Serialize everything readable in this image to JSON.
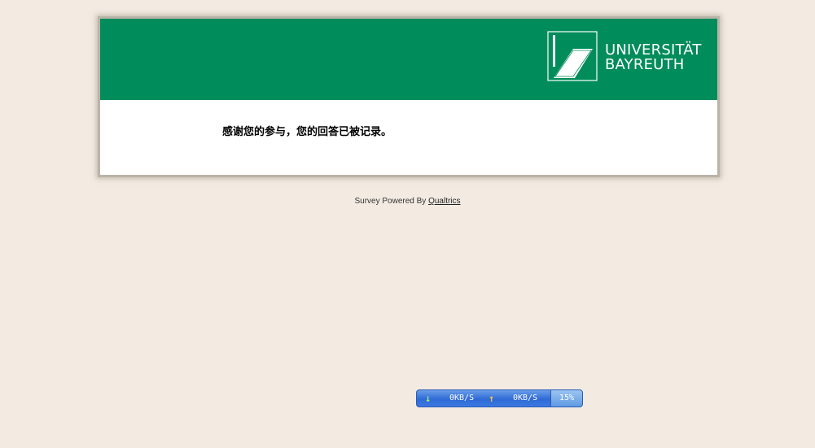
{
  "header": {
    "logo_line1": "UNIVERSITÄT",
    "logo_line2": "BAYREUTH"
  },
  "content": {
    "end_message": "感谢您的参与，您的回答已被记录。"
  },
  "footer": {
    "prefix": "Survey Powered By",
    "link_text": "Qualtrics"
  },
  "speed_widget": {
    "download_speed": "0KB/S",
    "upload_speed": "0KB/S",
    "percent": "15%",
    "download_icon": "arrow-down-icon",
    "upload_icon": "arrow-up-icon"
  },
  "colors": {
    "header_green": "#008c5b",
    "page_background": "#f3ebe2",
    "widget_blue": "#2f6ad6"
  }
}
